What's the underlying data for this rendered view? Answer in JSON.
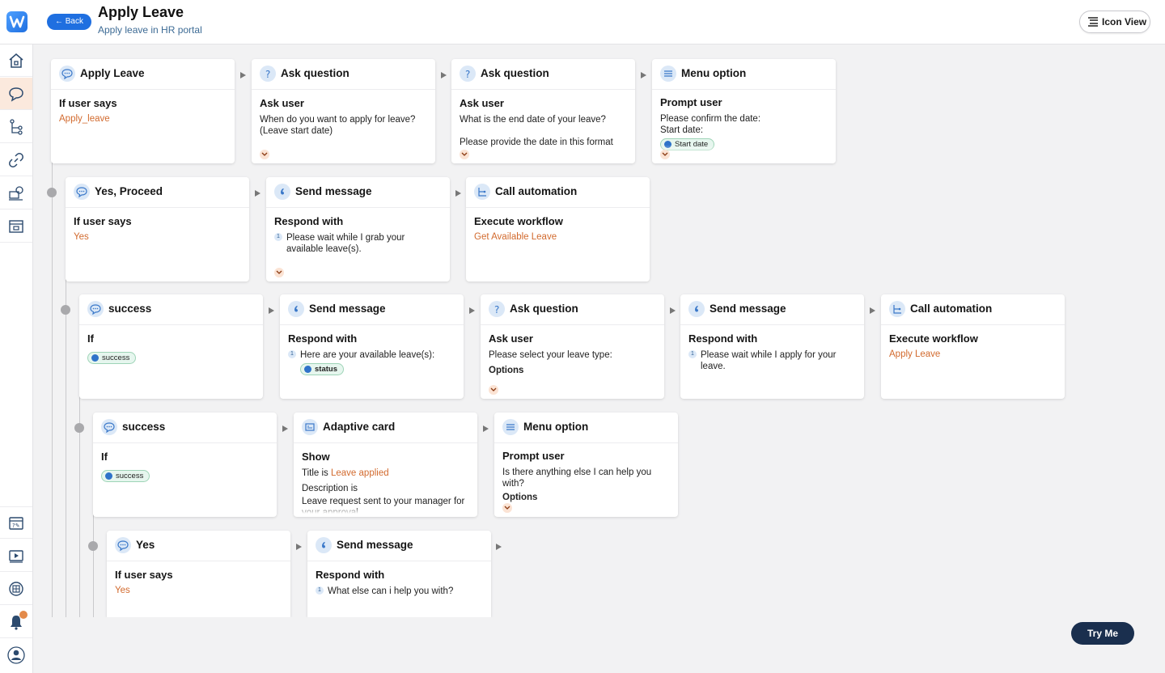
{
  "header": {
    "back_label": "← Back",
    "title": "Apply Leave",
    "subtitle": "Apply leave in HR portal",
    "icon_view_label": "Icon View"
  },
  "sidebar": {
    "items": [
      "home-icon",
      "chat-icon",
      "flow-tree-icon",
      "link-icon",
      "agent-icon",
      "inbox-icon",
      "faq-icon",
      "video-icon",
      "book-icon",
      "bell-icon",
      "user-icon"
    ],
    "active": "chat-icon",
    "notification_color": "#e38a4a"
  },
  "rows": [
    {
      "cards": [
        {
          "icon": "chat-bubble-icon",
          "title": "Apply Leave",
          "label": "If user says",
          "value": "Apply_leave"
        },
        {
          "icon": "question-icon",
          "title": "Ask question",
          "label": "Ask user",
          "text": "When do you want to apply for leave? (Leave start date)",
          "chevron": true
        },
        {
          "icon": "question-icon",
          "title": "Ask question",
          "label": "Ask user",
          "text": "What is the end date of your leave?",
          "text2": "Please provide the date in this format",
          "chevron": true
        },
        {
          "icon": "menu-icon",
          "title": "Menu option",
          "label": "Prompt user",
          "text": "Please confirm the date:",
          "text2": "Start date:",
          "chip": "Start date",
          "chevron": true
        }
      ]
    },
    {
      "cards": [
        {
          "icon": "chat-bubble-icon",
          "title": "Yes, Proceed",
          "label": "If user says",
          "value": "Yes"
        },
        {
          "icon": "quote-icon",
          "title": "Send message",
          "label": "Respond with",
          "numbered": [
            "Please wait while I grab your available leave(s)."
          ],
          "chevron": true
        },
        {
          "icon": "automation-icon",
          "title": "Call automation",
          "label": "Execute workflow",
          "value": "Get Available Leave"
        }
      ]
    },
    {
      "cards": [
        {
          "icon": "chat-bubble-icon",
          "title": "success",
          "label": "If",
          "chip": "success"
        },
        {
          "icon": "quote-icon",
          "title": "Send message",
          "label": "Respond with",
          "numbered": [
            "Here are your available leave(s):"
          ],
          "chip": "status"
        },
        {
          "icon": "question-icon",
          "title": "Ask question",
          "label": "Ask user",
          "text": "Please select your leave type:",
          "subhead": "Options",
          "chevron": true
        },
        {
          "icon": "quote-icon",
          "title": "Send message",
          "label": "Respond with",
          "numbered": [
            "Please wait while I apply for your leave."
          ]
        },
        {
          "icon": "automation-icon",
          "title": "Call automation",
          "label": "Execute workflow",
          "value": "Apply Leave"
        }
      ]
    },
    {
      "cards": [
        {
          "icon": "chat-bubble-icon",
          "title": "success",
          "label": "If",
          "chip": "success"
        },
        {
          "icon": "card-icon",
          "title": "Adaptive card",
          "label": "Show",
          "title_prefix": "Title is ",
          "title_value": "Leave applied",
          "desc_label": "Description is",
          "text": "Leave request sent to your manager for your approval."
        },
        {
          "icon": "menu-icon",
          "title": "Menu option",
          "label": "Prompt user",
          "text": "Is there anything else I can help you with?",
          "subhead": "Options",
          "chevron": true
        }
      ]
    },
    {
      "cards": [
        {
          "icon": "chat-bubble-icon",
          "title": "Yes",
          "label": "If user says",
          "value": "Yes"
        },
        {
          "icon": "quote-icon",
          "title": "Send message",
          "label": "Respond with",
          "numbered": [
            "What else can i help you with?"
          ]
        }
      ]
    }
  ],
  "try_me_label": "Try Me"
}
